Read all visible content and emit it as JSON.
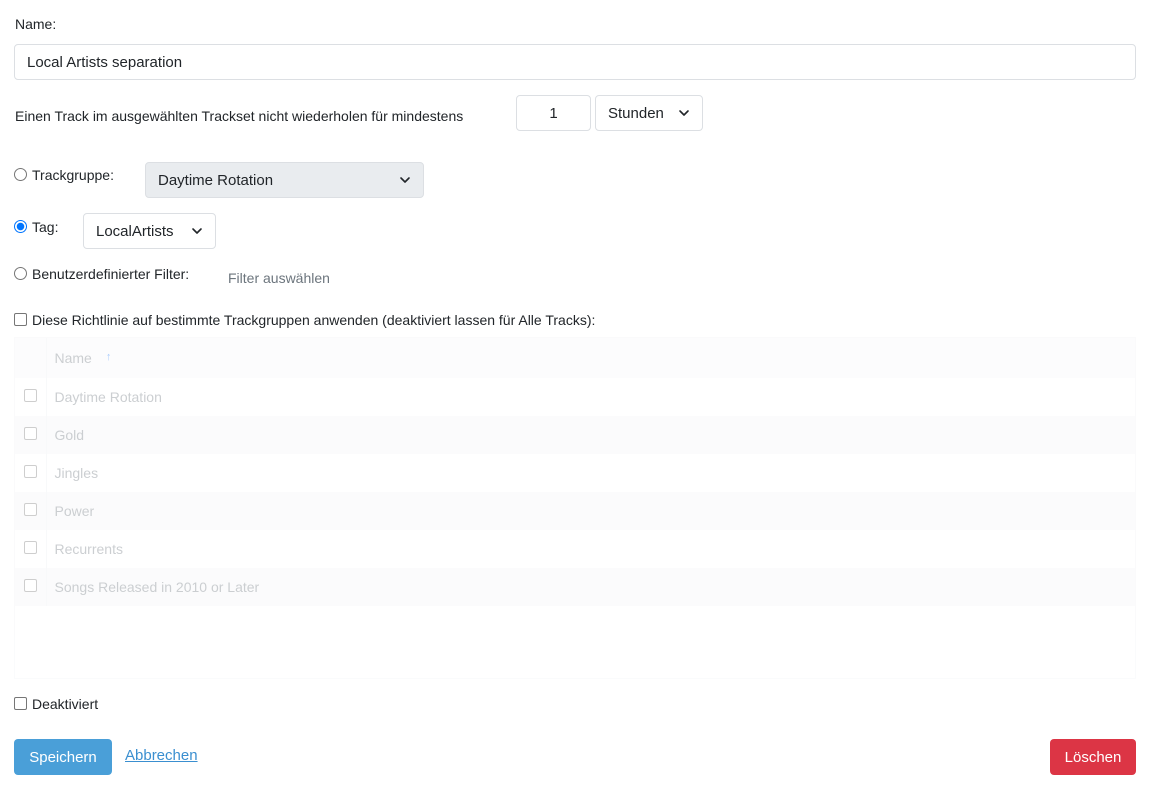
{
  "form": {
    "name_label": "Name:",
    "name_value": "Local Artists separation",
    "repeat_label": "Einen Track im ausgewählten Trackset nicht wiederholen für mindestens",
    "repeat_value": "1",
    "repeat_unit": "Stunden"
  },
  "source": {
    "trackgroup_label": "Trackgruppe:",
    "trackgroup_value": "Daytime Rotation",
    "tag_label": "Tag:",
    "tag_value": "LocalArtists",
    "custom_filter_label": "Benutzerdefinierter Filter:",
    "custom_filter_link": "Filter auswählen",
    "selected": "tag"
  },
  "apply": {
    "label": "Diese Richtlinie auf bestimmte Trackgruppen anwenden (deaktiviert lassen für Alle Tracks):",
    "checked": false
  },
  "table": {
    "name_header": "Name",
    "sort_icon": "arrow-up-icon",
    "rows": [
      "Daytime Rotation",
      "Gold",
      "Jingles",
      "Power",
      "Recurrents",
      "Songs Released in 2010 or Later"
    ]
  },
  "disabled": {
    "label": "Deaktiviert",
    "checked": false
  },
  "actions": {
    "save": "Speichern",
    "cancel": "Abbrechen",
    "delete": "Löschen"
  },
  "colors": {
    "primary": "#4a9fd8",
    "danger": "#dc3545",
    "link": "#3a8fd0",
    "radio_accent": "#0075ff"
  }
}
